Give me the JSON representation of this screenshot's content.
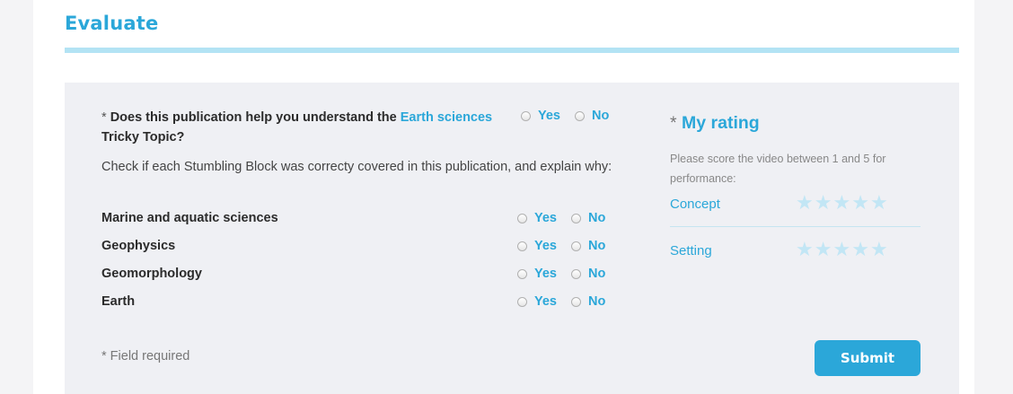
{
  "title": "Evaluate",
  "question": {
    "required_mark": "*",
    "text_before": "Does this publication help you understand the",
    "highlight": "Earth sciences",
    "text_after": "Tricky Topic?"
  },
  "instruction": "Check if each Stumbling Block was correcty covered in this publication, and explain why:",
  "options": {
    "yes": "Yes",
    "no": "No"
  },
  "stumbling_blocks": [
    {
      "label": "Marine and aquatic sciences"
    },
    {
      "label": "Geophysics"
    },
    {
      "label": "Geomorphology"
    },
    {
      "label": "Earth"
    }
  ],
  "field_required": "* Field required",
  "rating": {
    "required_mark": "*",
    "title": "My rating",
    "description": "Please score the video between 1 and 5 for performance:",
    "items": [
      {
        "label": "Concept",
        "stars": 0,
        "max": 5
      },
      {
        "label": "Setting",
        "stars": 0,
        "max": 5
      }
    ]
  },
  "submit_label": "Submit",
  "colors": {
    "accent": "#2ba7d9",
    "panel": "#eff0f4",
    "rule": "#b3e3f4",
    "star_empty": "#c2e6f5"
  }
}
